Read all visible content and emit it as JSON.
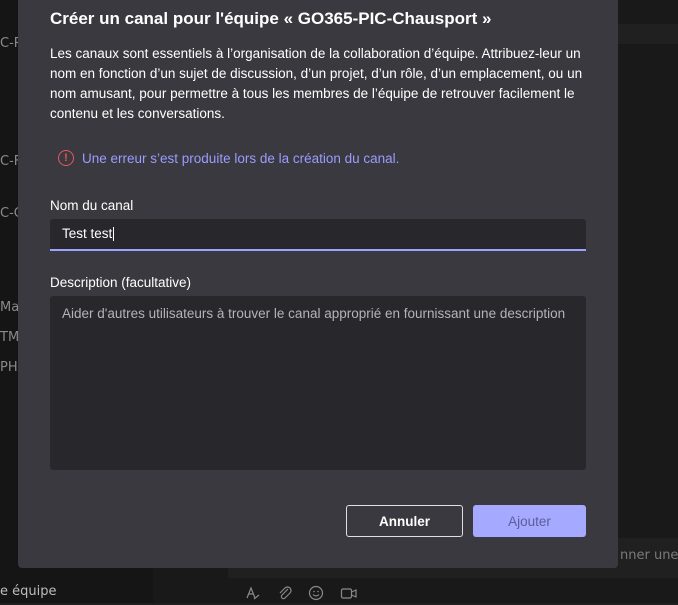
{
  "background": {
    "left_items": [
      "C-R",
      "C-F",
      "C-C",
      "Mac",
      "TMA",
      "PHF"
    ],
    "team_label": "e équipe",
    "compose_placeholder": "nner une p",
    "toolbar_icons": [
      "format-icon",
      "attach-icon",
      "emoji-icon",
      "meet-icon"
    ]
  },
  "dialog": {
    "title": "Créer un canal pour l'équipe « GO365-PIC-Chausport »",
    "description": "Les canaux sont essentiels à l’organisation de la collaboration d’équipe. Attribuez-leur un nom en fonction d’un sujet de discussion, d’un projet, d’un rôle, d’un emplacement, ou un nom amusant, pour permettre à tous les membres de l’équipe de retrouver facilement le contenu et les conversations.",
    "error_icon": "!",
    "error_text": "Une erreur s’est produite lors de la création du canal.",
    "name_label": "Nom du canal",
    "name_value": "Test test",
    "desc_label": "Description (facultative)",
    "desc_placeholder": "Aider d'autres utilisateurs à trouver le canal approprié en fournissant une description",
    "cancel_label": "Annuler",
    "add_label": "Ajouter"
  },
  "colors": {
    "dialog_bg": "#3a393f",
    "input_bg": "#28272c",
    "accent": "#9ea2ff",
    "error": "#e8575e",
    "error_text": "#9a9cff",
    "primary_button_disabled": "#a5a9ff"
  }
}
